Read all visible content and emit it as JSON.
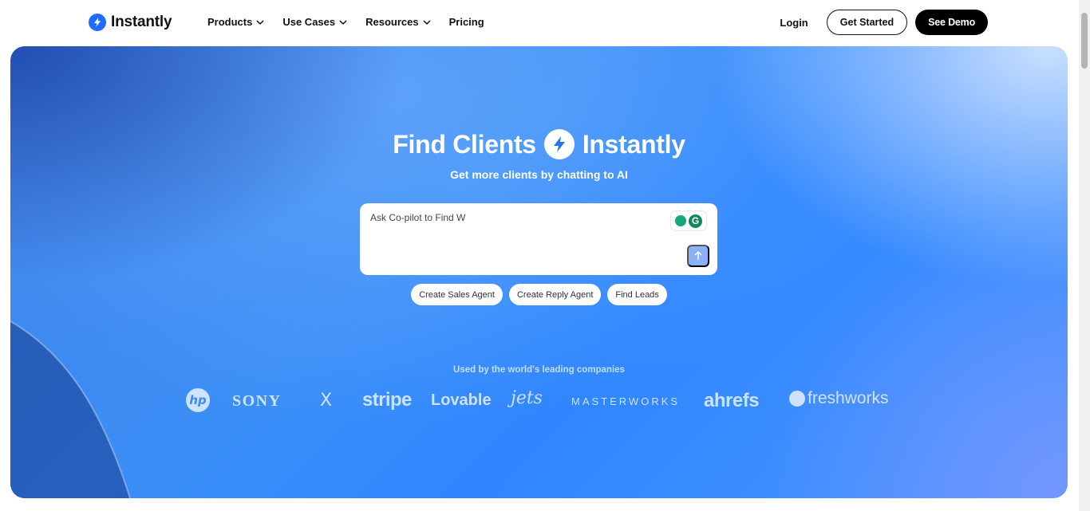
{
  "brand": {
    "name": "Instantly",
    "accent": "#1f6bff"
  },
  "nav": {
    "items": [
      {
        "label": "Products",
        "dropdown": true
      },
      {
        "label": "Use Cases",
        "dropdown": true
      },
      {
        "label": "Resources",
        "dropdown": true
      },
      {
        "label": "Pricing",
        "dropdown": false
      }
    ],
    "login": "Login",
    "get_started": "Get Started",
    "see_demo": "See Demo"
  },
  "hero": {
    "title_left": "Find Clients",
    "title_right": "Instantly",
    "subtitle": "Get more clients by chatting to AI",
    "input": {
      "value": "Ask Co-pilot to Find W",
      "placeholder": ""
    },
    "ext_icon_label": "G",
    "chips": [
      "Create Sales Agent",
      "Create Reply Agent",
      "Find Leads"
    ],
    "used_by": "Used by the world's leading companies",
    "logos": [
      "hp",
      "SONY",
      "X",
      "stripe",
      "Lovable",
      "jets",
      "MASTERWORKS",
      "ahrefs",
      "freshworks"
    ]
  }
}
